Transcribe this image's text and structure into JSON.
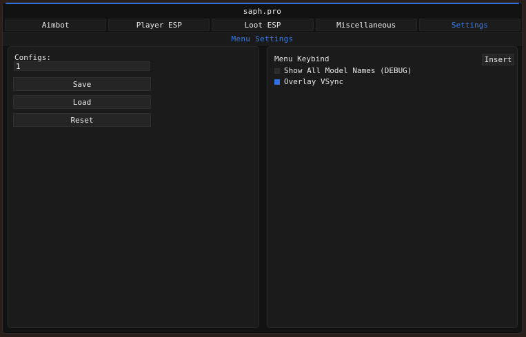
{
  "window": {
    "title": "saph.pro"
  },
  "tabs": [
    {
      "label": "Aimbot",
      "active": false
    },
    {
      "label": "Player ESP",
      "active": false
    },
    {
      "label": "Loot ESP",
      "active": false
    },
    {
      "label": "Miscellaneous",
      "active": false
    },
    {
      "label": "Settings",
      "active": true
    }
  ],
  "section": {
    "title": "Menu Settings"
  },
  "configs": {
    "label": "Configs:",
    "value": "1",
    "buttons": {
      "save": "Save",
      "load": "Load",
      "reset": "Reset"
    }
  },
  "menu": {
    "keybind_label": "Menu Keybind",
    "keybind_value": "Insert",
    "options": [
      {
        "label": "Show All Model Names (DEBUG)",
        "checked": false
      },
      {
        "label": "Overlay VSync",
        "checked": true
      }
    ]
  },
  "colors": {
    "accent": "#2f6fe0",
    "background": "#121212",
    "panel": "#1b1b1b"
  }
}
